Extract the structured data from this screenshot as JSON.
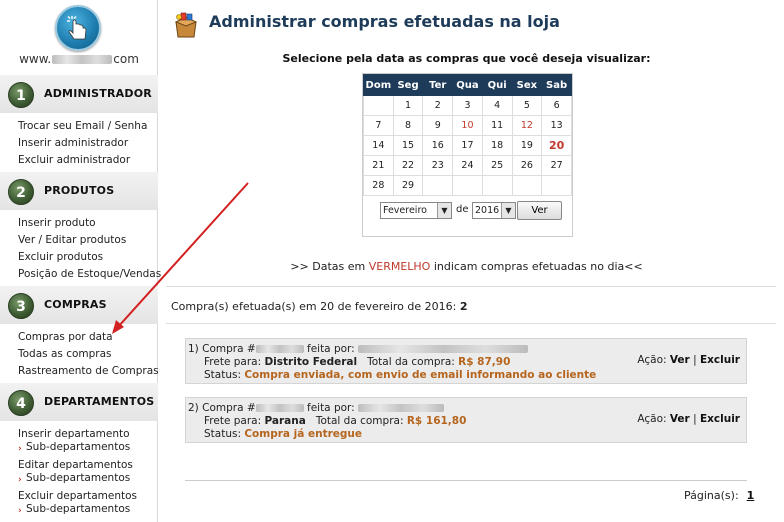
{
  "logo": {
    "prefix": "www.",
    "suffix": "com"
  },
  "sidebar": {
    "sections": [
      {
        "num": "1",
        "title": "ADMINISTRADOR",
        "items": [
          "Trocar seu Email / Senha",
          "Inserir administrador",
          "Excluir administrador"
        ]
      },
      {
        "num": "2",
        "title": "PRODUTOS",
        "items": [
          "Inserir produto",
          "Ver / Editar produtos",
          "Excluir produtos",
          "Posição de Estoque/Vendas"
        ]
      },
      {
        "num": "3",
        "title": "COMPRAS",
        "items": [
          "Compras por data",
          "Todas as compras",
          "Rastreamento de Compras"
        ]
      },
      {
        "num": "4",
        "title": "DEPARTAMENTOS",
        "items": [
          "Inserir departamento",
          "Sub-departamentos",
          "Editar departamentos",
          "Sub-departamentos",
          "Excluir departamentos",
          "Sub-departamentos"
        ]
      }
    ]
  },
  "main": {
    "title": "Administrar compras efetuadas na loja",
    "subtitle": "Selecione pela data as compras que você deseja visualizar:",
    "calendar": {
      "weekdays": [
        "Dom",
        "Seg",
        "Ter",
        "Qua",
        "Qui",
        "Sex",
        "Sab"
      ],
      "weeks": [
        [
          "",
          "1",
          "2",
          "3",
          "4",
          "5",
          "6"
        ],
        [
          "7",
          "8",
          "9",
          "10",
          "11",
          "12",
          "13"
        ],
        [
          "14",
          "15",
          "16",
          "17",
          "18",
          "19",
          "20"
        ],
        [
          "21",
          "22",
          "23",
          "24",
          "25",
          "26",
          "27"
        ],
        [
          "28",
          "29",
          "",
          "",
          "",
          "",
          ""
        ]
      ],
      "red_days": [
        "10",
        "12"
      ],
      "selected_day": "20",
      "month": "Fevereiro",
      "de_label": "de",
      "year": "2016",
      "button": "Ver"
    },
    "legend": {
      "before": ">> Datas em ",
      "highlight": "VERMELHO",
      "after": " indicam compras efetuadas no dia<<"
    },
    "summary": {
      "label": "Compra(s) efetuada(s) em 20 de fevereiro de 2016:",
      "count": "2"
    },
    "orders": [
      {
        "prefix": "1) Compra #",
        "made_by": " feita por:",
        "frete_label": "Frete para:",
        "frete_value": "Distrito Federal",
        "total_label": "Total da compra:",
        "total_value": "R$ 87,90",
        "status_label": "Status:",
        "status_value": "Compra enviada, com envio de email informando ao cliente",
        "action_label": "Ação:",
        "ver": "Ver",
        "sep": "|",
        "excluir": "Excluir"
      },
      {
        "prefix": "2) Compra #",
        "made_by": " feita por:",
        "frete_label": "Frete para:",
        "frete_value": "Parana",
        "total_label": "Total da compra:",
        "total_value": "R$ 161,80",
        "status_label": "Status:",
        "status_value": "Compra já entregue",
        "action_label": "Ação:",
        "ver": "Ver",
        "sep": "|",
        "excluir": "Excluir"
      }
    ],
    "pagination": {
      "label": "Página(s):",
      "page": "1"
    }
  },
  "colors": {
    "header_blue": "#1f3b5a",
    "accent_red": "#c0392b",
    "status_orange": "#b5651d",
    "annotation_arrow": "#d32020"
  }
}
